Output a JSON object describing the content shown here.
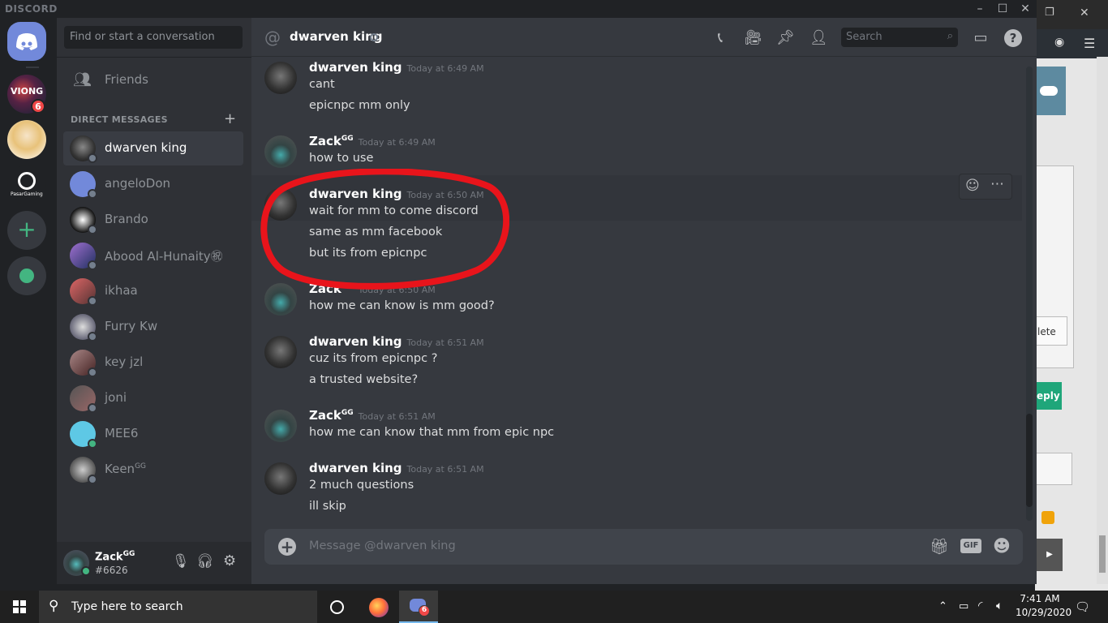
{
  "app": {
    "brand": "DISCORD"
  },
  "rail": {
    "server_badge": "6"
  },
  "sidebar": {
    "search_placeholder": "Find or start a conversation",
    "friends_label": "Friends",
    "dm_header": "DIRECT MESSAGES",
    "add_dm": "+",
    "dms": [
      {
        "name": "dwarven king",
        "status": "offline",
        "active": true
      },
      {
        "name": "angeloDon",
        "status": "offline"
      },
      {
        "name": "Brando",
        "status": "offline"
      },
      {
        "name": "Abood Al-Hunaity㊗",
        "status": "offline"
      },
      {
        "name": "ikhaa",
        "status": "offline"
      },
      {
        "name": "Furry Kw",
        "status": "offline"
      },
      {
        "name": "key jzl",
        "status": "offline"
      },
      {
        "name": "joni",
        "status": "offline"
      },
      {
        "name": "MEE6",
        "status": "online"
      },
      {
        "name": "Keen",
        "sup": "GG",
        "status": "offline"
      }
    ]
  },
  "user_panel": {
    "name": "Zack",
    "sup": "GG",
    "tag": "#6626"
  },
  "chat": {
    "header_name": "dwarven king",
    "header_search": "Search",
    "composer_placeholder": "Message @dwarven king",
    "gif_label": "GIF",
    "messages": [
      {
        "author": "dwarven king",
        "time": "Today at 6:49 AM",
        "lines": [
          "cant",
          "epicnpc mm only"
        ]
      },
      {
        "author": "Zack",
        "sup": "GG",
        "time": "Today at 6:49 AM",
        "lines": [
          "how to use"
        ]
      },
      {
        "author": "dwarven king",
        "time": "Today at 6:50 AM",
        "lines": [
          "wait for mm to come discord",
          "same as mm facebook",
          "but its from epicnpc"
        ]
      },
      {
        "author": "Zack",
        "sup": "GG",
        "time": "Today at 6:50 AM",
        "lines": [
          "how me can know is mm good?"
        ]
      },
      {
        "author": "dwarven king",
        "time": "Today at 6:51 AM",
        "lines": [
          "cuz its from epicnpc ?",
          "a trusted website?"
        ]
      },
      {
        "author": "Zack",
        "sup": "GG",
        "time": "Today at 6:51 AM",
        "lines": [
          "how me can know that mm from epic npc"
        ]
      },
      {
        "author": "dwarven king",
        "time": "Today at 6:51 AM",
        "lines": [
          "2 much questions",
          "ill skip"
        ]
      }
    ]
  },
  "background_window": {
    "delete_fragment": "lete",
    "reply_fragment": "eply"
  },
  "taskbar": {
    "search_placeholder": "Type here to search",
    "discord_badge": "6",
    "time": "7:41 AM",
    "date": "10/29/2020"
  },
  "colors": {
    "blurple": "#7289da",
    "red_annotation": "#e8141b",
    "online": "#43b581"
  }
}
